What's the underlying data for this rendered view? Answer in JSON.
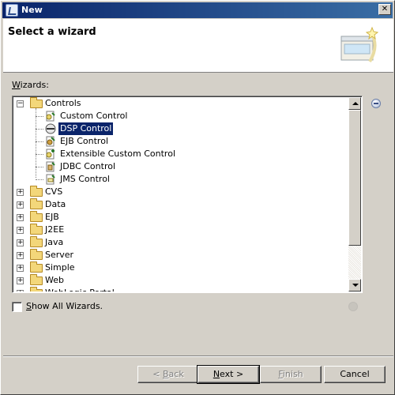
{
  "window": {
    "title": "New",
    "close_glyph": "✕"
  },
  "header": {
    "title": "Select a wizard",
    "art_icon": "wizard-banner-icon"
  },
  "wizards": {
    "label_accel": "W",
    "label_rest": "izards:",
    "tree": [
      {
        "label": "Controls",
        "expanded": true,
        "icon": "folder-icon"
      },
      {
        "label": "Custom Control",
        "child": true,
        "icon": "custom-control-icon"
      },
      {
        "label": "DSP Control",
        "child": true,
        "icon": "dsp-control-icon",
        "selected": true
      },
      {
        "label": "EJB Control",
        "child": true,
        "icon": "ejb-control-icon"
      },
      {
        "label": "Extensible Custom Control",
        "child": true,
        "icon": "extensible-control-icon"
      },
      {
        "label": "JDBC Control",
        "child": true,
        "icon": "jdbc-control-icon"
      },
      {
        "label": "JMS Control",
        "child": true,
        "icon": "jms-control-icon"
      },
      {
        "label": "CVS",
        "expanded": false,
        "icon": "folder-icon"
      },
      {
        "label": "Data",
        "expanded": false,
        "icon": "folder-icon"
      },
      {
        "label": "EJB",
        "expanded": false,
        "icon": "folder-icon"
      },
      {
        "label": "J2EE",
        "expanded": false,
        "icon": "folder-icon"
      },
      {
        "label": "Java",
        "expanded": false,
        "icon": "folder-icon"
      },
      {
        "label": "Server",
        "expanded": false,
        "icon": "folder-icon"
      },
      {
        "label": "Simple",
        "expanded": false,
        "icon": "folder-icon"
      },
      {
        "label": "Web",
        "expanded": false,
        "icon": "folder-icon"
      },
      {
        "label": "WebLogic Portal",
        "expanded": false,
        "icon": "folder-icon"
      }
    ]
  },
  "show_all": {
    "label_accel": "S",
    "label_rest": "how All Wizards.",
    "checked": false
  },
  "buttons": {
    "back_prefix": "< ",
    "back_accel": "B",
    "back_rest": "ack",
    "next_accel": "N",
    "next_rest": "ext >",
    "finish_accel": "F",
    "finish_rest": "inish",
    "cancel": "Cancel"
  },
  "colors": {
    "titlebar": "#0a246a",
    "selection": "#0a246a",
    "dialog_bg": "#d4d0c8"
  }
}
